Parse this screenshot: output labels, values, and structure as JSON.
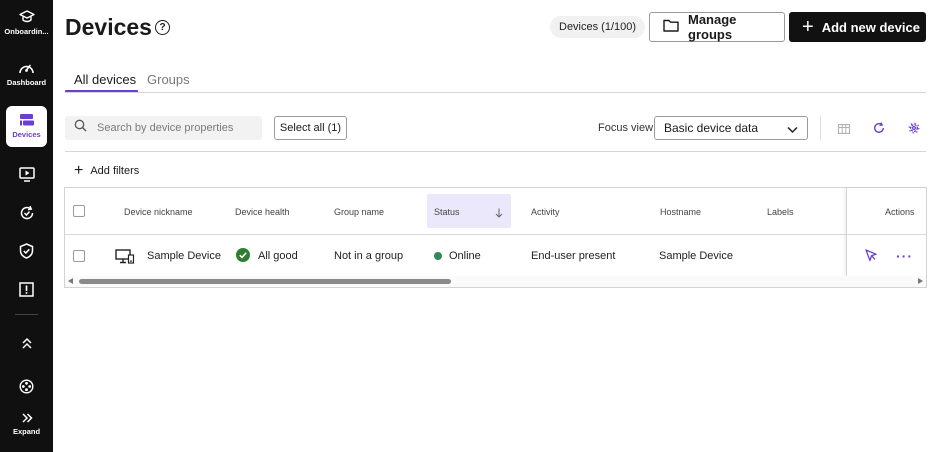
{
  "sidebar": {
    "items": [
      {
        "label": "Onboardin...",
        "icon": "graduation-cap-icon"
      },
      {
        "label": "Dashboard",
        "icon": "speedometer-icon"
      },
      {
        "label": "Devices",
        "icon": "devices-icon"
      },
      {
        "label": "",
        "icon": "monitor-play-icon"
      },
      {
        "label": "",
        "icon": "sync-check-icon"
      },
      {
        "label": "",
        "icon": "shield-check-icon"
      },
      {
        "label": "",
        "icon": "alert-box-icon"
      },
      {
        "label": "",
        "icon": "chevrons-up-icon"
      },
      {
        "label": "",
        "icon": "film-reel-icon"
      },
      {
        "label": "Expand",
        "icon": "chevrons-right-icon"
      }
    ],
    "active_index": 2
  },
  "header": {
    "title": "Devices",
    "count_badge": "Devices (1/100)",
    "manage_groups": "Manage groups",
    "add_device": "Add new device"
  },
  "tabs": [
    {
      "label": "All devices",
      "active": true
    },
    {
      "label": "Groups",
      "active": false
    }
  ],
  "toolbar": {
    "search_placeholder": "Search by device properties",
    "select_all": "Select all (1)",
    "focus_label": "Focus view",
    "focus_value": "Basic device data",
    "add_filters": "Add filters"
  },
  "table": {
    "columns": [
      "Device nickname",
      "Device health",
      "Group name",
      "Status",
      "Activity",
      "Hostname",
      "Labels",
      "Actions"
    ],
    "sorted_column": "Status",
    "rows": [
      {
        "nickname": "Sample Device",
        "health": "All good",
        "group": "Not in a group",
        "status": "Online",
        "activity": "End-user present",
        "hostname": "Sample Device",
        "labels": ""
      }
    ]
  },
  "colors": {
    "accent": "#6a3fd1",
    "online": "#2e8b57",
    "health_good": "#2e7d32",
    "sidebar_bg": "#101010"
  }
}
